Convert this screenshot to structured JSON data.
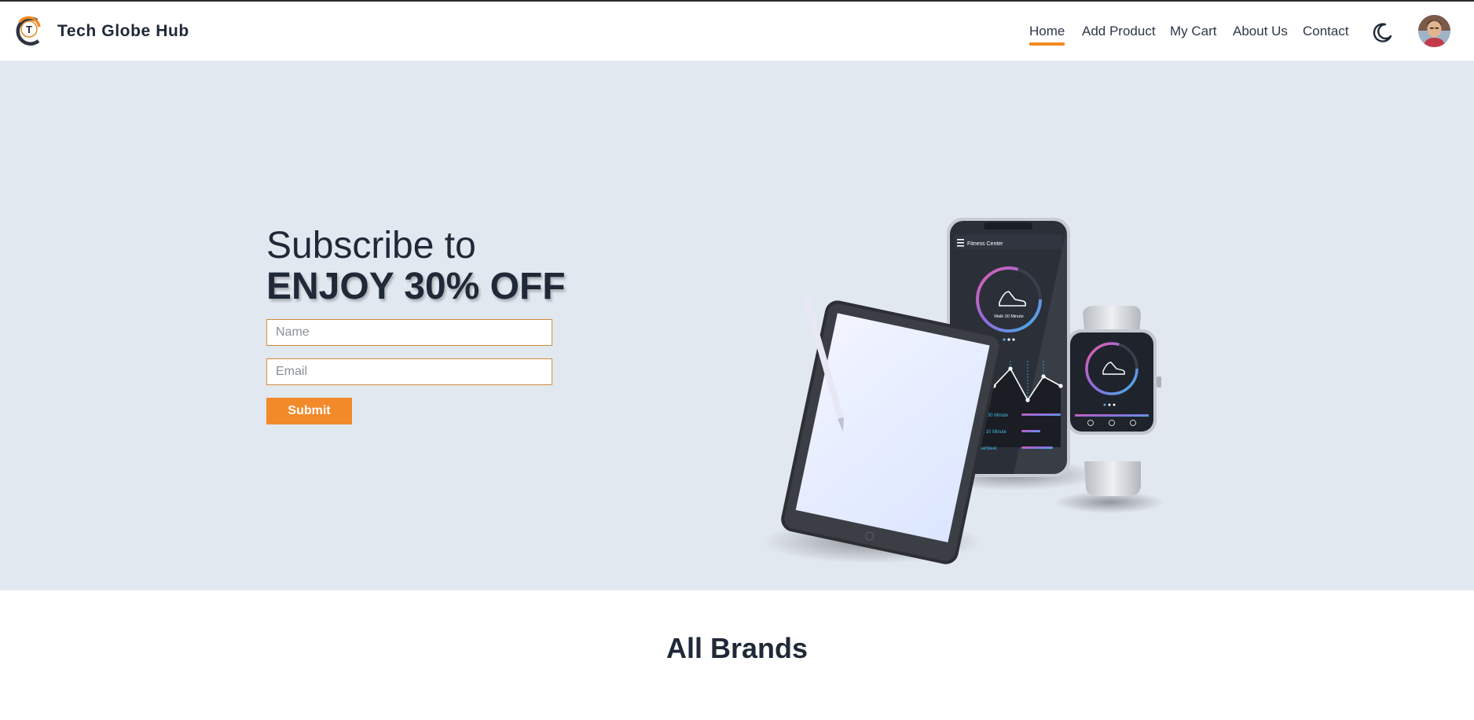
{
  "header": {
    "logo_letter": "T",
    "brand_name": "Tech Globe Hub",
    "nav": [
      {
        "label": "Home",
        "active": true
      },
      {
        "label": "Add Product",
        "active": false
      },
      {
        "label": "My Cart",
        "active": false
      },
      {
        "label": "About Us",
        "active": false
      },
      {
        "label": "Contact",
        "active": false
      }
    ],
    "theme_icon": "moon-icon",
    "accent_color": "#f28a1e"
  },
  "hero": {
    "line1": "Subscribe to",
    "line2": "ENJOY 30% OFF",
    "name_placeholder": "Name",
    "email_placeholder": "Email",
    "submit_label": "Submit",
    "background": "#e2e8f0",
    "image": {
      "phone_app_title": "Fitness Center",
      "ring_text": "Walk 30 Minute",
      "list_items": [
        "Walk 30 Minute",
        "Run 10 Minute",
        "Heartbeat"
      ]
    }
  },
  "brands": {
    "title": "All Brands"
  }
}
